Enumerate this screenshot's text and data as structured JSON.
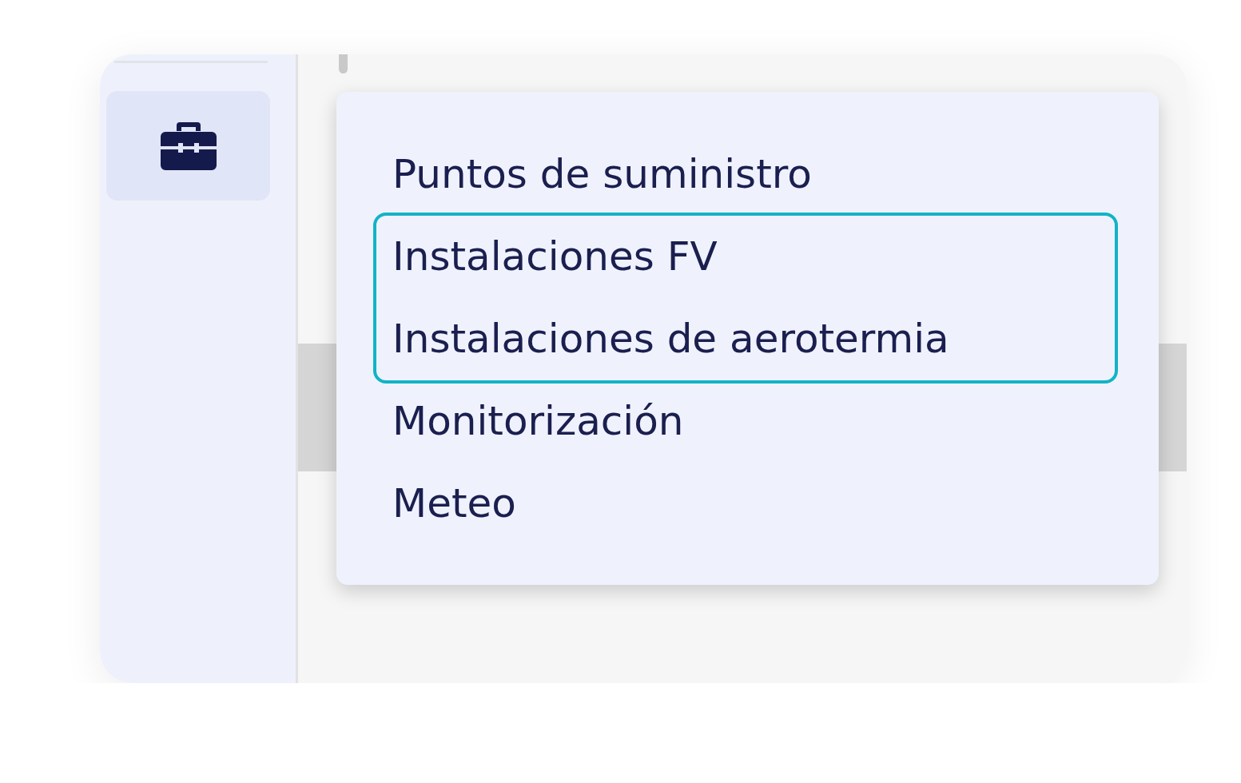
{
  "sidebar": {
    "items": [
      {
        "selected": true
      }
    ]
  },
  "menu": {
    "items": [
      {
        "label": "Puntos de suministro",
        "highlighted": false
      },
      {
        "label": "Instalaciones FV",
        "highlighted": true
      },
      {
        "label": "Instalaciones de aerotermia",
        "highlighted": true
      },
      {
        "label": "Monitorización",
        "highlighted": false
      },
      {
        "label": "Meteo",
        "highlighted": false
      }
    ]
  }
}
